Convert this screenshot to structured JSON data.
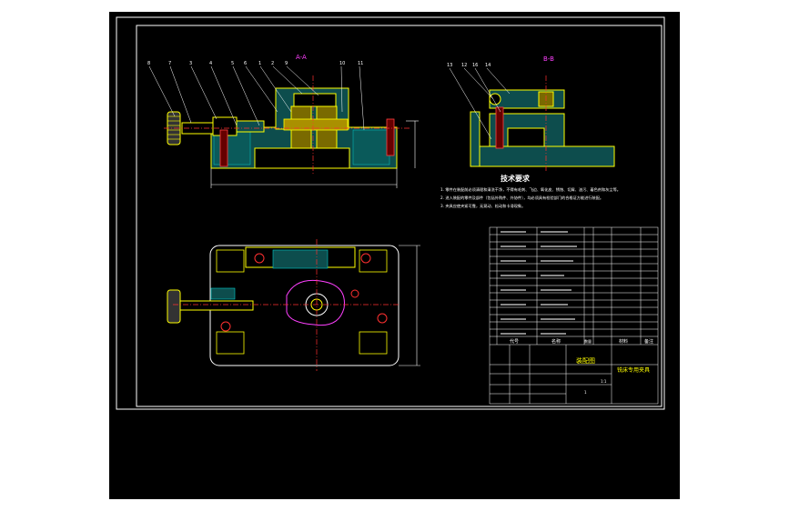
{
  "drawing": {
    "section_label_ab": "A-A",
    "section_label_b": "B-B",
    "tech_title": "技术要求",
    "tech_notes": [
      "1. 零件在装配前必须清理和清洗干净，不得有毛刺、飞边、氧化皮、锈蚀、切屑、油污、着色剂和灰尘等。",
      "2. 进入装配的零件及部件（包括外购件、外协件），均必须具有检验部门的合格证方能进行装配。",
      "3. 夹具应使夹紧可靠，无晃动、松动和卡滞现象。"
    ],
    "title_block": {
      "drawing_name": "装配图",
      "part_name": "铣床专用夹具",
      "header_code": "代号",
      "header_name": "名称",
      "header_qty": "数量",
      "header_material": "材料",
      "header_note": "备注",
      "scale": "1:1",
      "sheet": "1"
    },
    "colors": {
      "background": "#000000",
      "frame": "#ffffff",
      "part_line": "#ffff00",
      "hatch": "#00cccc",
      "text": "#ffffff",
      "red_line": "#ff3030",
      "magenta": "#ff40ff",
      "block_text": "#ffff00"
    }
  }
}
